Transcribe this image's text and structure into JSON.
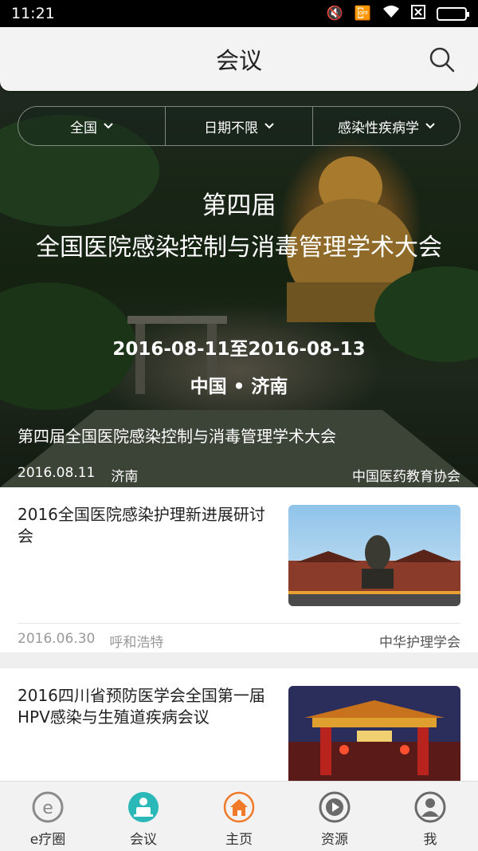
{
  "status_bar": {
    "time": "11:21",
    "icons": [
      "mute-icon",
      "vibrate-off-icon",
      "wifi-icon",
      "sim-disabled-icon",
      "battery-icon"
    ]
  },
  "header": {
    "title": "会议",
    "search_icon": "search-icon"
  },
  "filters": [
    {
      "label": "全国",
      "icon": "chevron-down-icon"
    },
    {
      "label": "日期不限",
      "icon": "chevron-down-icon"
    },
    {
      "label": "感染性疾病学",
      "icon": "chevron-down-icon"
    }
  ],
  "featured": {
    "banner_line1": "第四届",
    "banner_line2": "全国医院感染控制与消毒管理学术大会",
    "banner_dates": "2016-08-11至2016-08-13",
    "banner_location": "中国 • 济南",
    "caption": "第四届全国医院感染控制与消毒管理学术大会",
    "date": "2016.08.11",
    "city": "济南",
    "organizer": "中国医药教育协会"
  },
  "conferences": [
    {
      "title": "2016全国医院感染护理新进展研讨会",
      "date": "2016.06.30",
      "city": "呼和浩特",
      "organizer": "中华护理学会"
    },
    {
      "title": "2016四川省预防医学会全国第一届HPV感染与生殖道疾病会议",
      "date": "",
      "city": "",
      "organizer": ""
    }
  ],
  "tabbar": [
    {
      "label": "e疗圈",
      "icon": "e-circle-icon",
      "color": "#8a8a8a"
    },
    {
      "label": "会议",
      "icon": "meeting-icon",
      "color": "#2ab8b8"
    },
    {
      "label": "主页",
      "icon": "home-icon",
      "color": "#f07a2a"
    },
    {
      "label": "资源",
      "icon": "play-icon",
      "color": "#6a6a6a"
    },
    {
      "label": "我",
      "icon": "user-icon",
      "color": "#6a6a6a"
    }
  ]
}
